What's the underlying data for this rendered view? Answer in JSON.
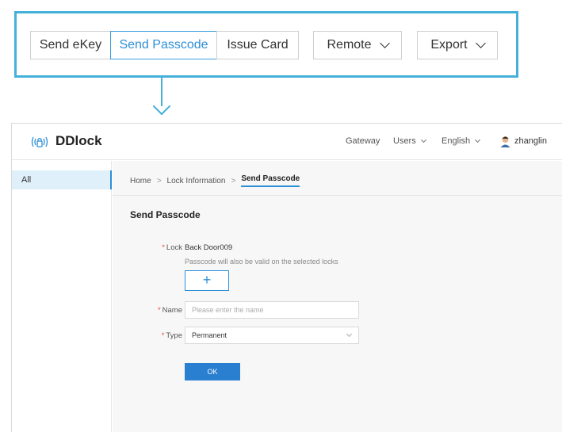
{
  "toolbar": {
    "send_ekey": "Send eKey",
    "send_passcode": "Send Passcode",
    "issue_card": "Issue Card",
    "remote": "Remote",
    "export": "Export"
  },
  "app": {
    "logo_text": "DDlock",
    "nav": {
      "gateway": "Gateway",
      "users": "Users",
      "language": "English",
      "user_name": "zhanglin"
    },
    "sidebar": {
      "items": [
        {
          "label": "All"
        }
      ]
    },
    "breadcrumb": {
      "home": "Home",
      "sep": ">",
      "lock_info": "Lock Information",
      "current": "Send Passcode"
    },
    "form": {
      "title": "Send Passcode",
      "required_mark": "*",
      "lock_label": "Lock",
      "lock_value": "Back Door009",
      "lock_hint": "Passcode will also be valid on the selected locks",
      "add_label": "+",
      "name_label": "Name",
      "name_placeholder": "Please enter the name",
      "type_label": "Type",
      "type_value": "Permanent",
      "ok_label": "OK"
    }
  },
  "colors": {
    "accent": "#2d8fd6",
    "callout_border": "#45b0d8",
    "required": "#e04b4b"
  }
}
